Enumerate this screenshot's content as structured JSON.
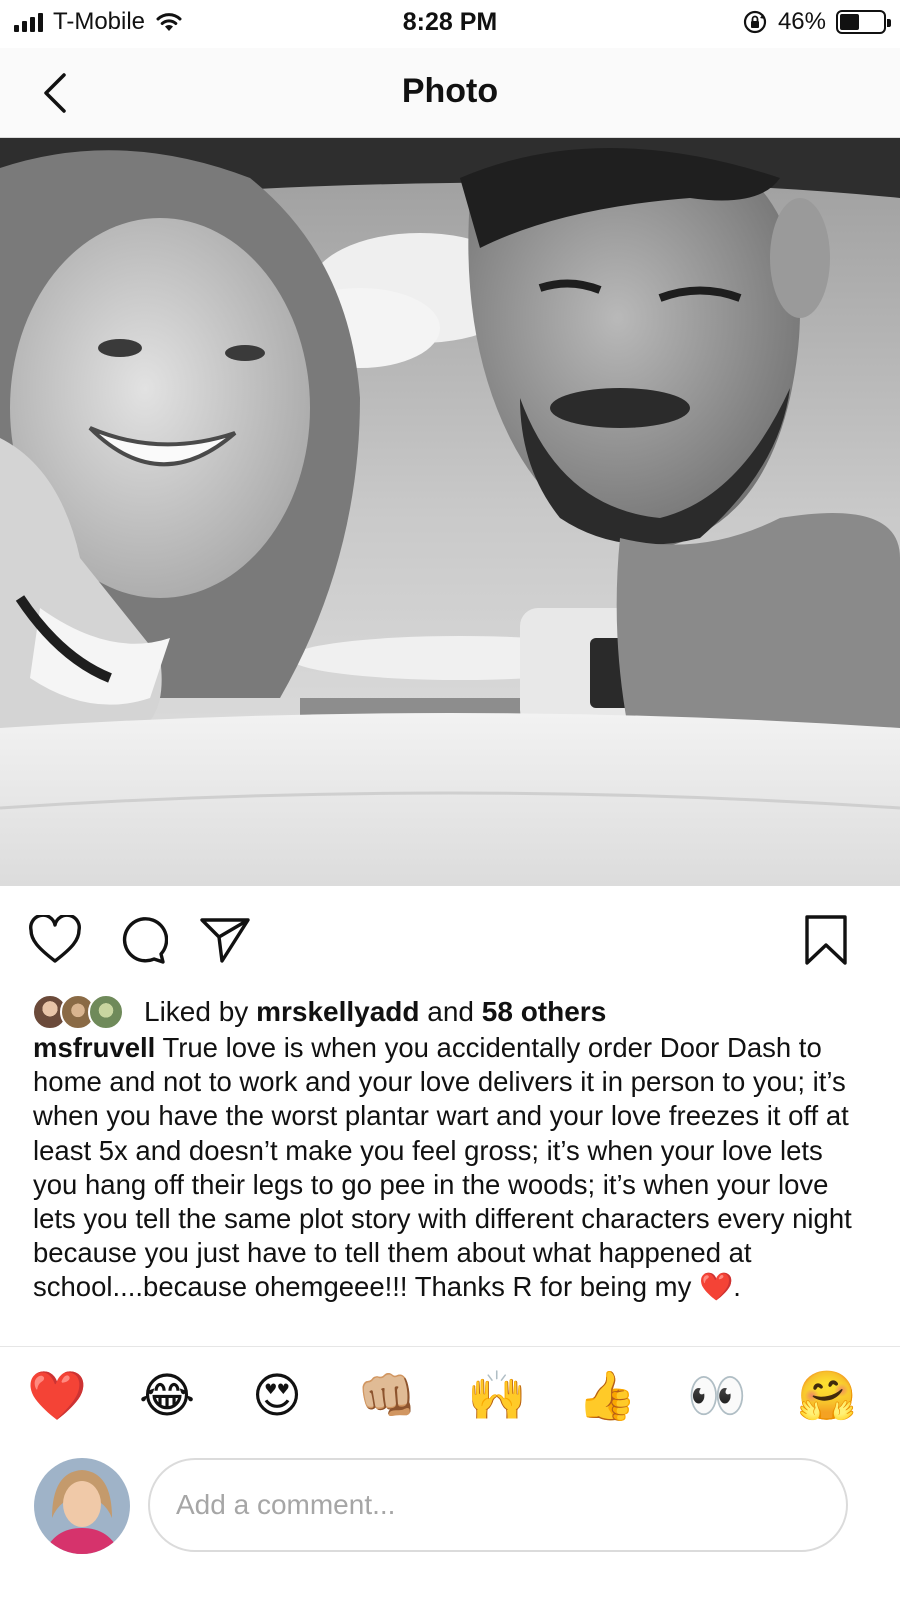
{
  "status_bar": {
    "carrier": "T-Mobile",
    "time": "8:28 PM",
    "battery_percent_label": "46%",
    "battery_level": 0.46,
    "icons": [
      "signal-bars-icon",
      "wifi-icon",
      "rotation-lock-icon",
      "battery-icon"
    ]
  },
  "nav": {
    "title": "Photo",
    "back_icon": "chevron-left-icon"
  },
  "post": {
    "photo_icon": "photo",
    "actions": [
      "heart-icon",
      "comment-icon",
      "share-icon",
      "bookmark-icon"
    ],
    "likes": {
      "prefix": "Liked by",
      "user": "mrskellyadd",
      "conjunction": "and",
      "others": "58 others"
    },
    "caption": {
      "username": "msfruvell",
      "text": "True love is when you accidentally order Door Dash to home and not to work and your love delivers it in person to you; it’s when you have the worst plantar wart and your love freezes it off at least 5x and doesn’t make you feel gross; it’s when your love lets you hang off their legs to go pee in the woods; it’s when your love lets you tell the same plot story with different characters every night because you just have to tell them about what happened at school....because ohemgeee!!! Thanks R for being my",
      "heart_emoji": "❤️",
      "ending": "."
    }
  },
  "reactions": {
    "emojis": [
      "❤️",
      "😂",
      "😍",
      "👊🏼",
      "🙌",
      "👍",
      "👀",
      "🤗"
    ]
  },
  "comment": {
    "placeholder": "Add a comment..."
  },
  "colors": {
    "text": "#111111",
    "placeholder": "#a6a6a6",
    "divider": "#dbdbdb",
    "heart_red": "#e0202e"
  }
}
